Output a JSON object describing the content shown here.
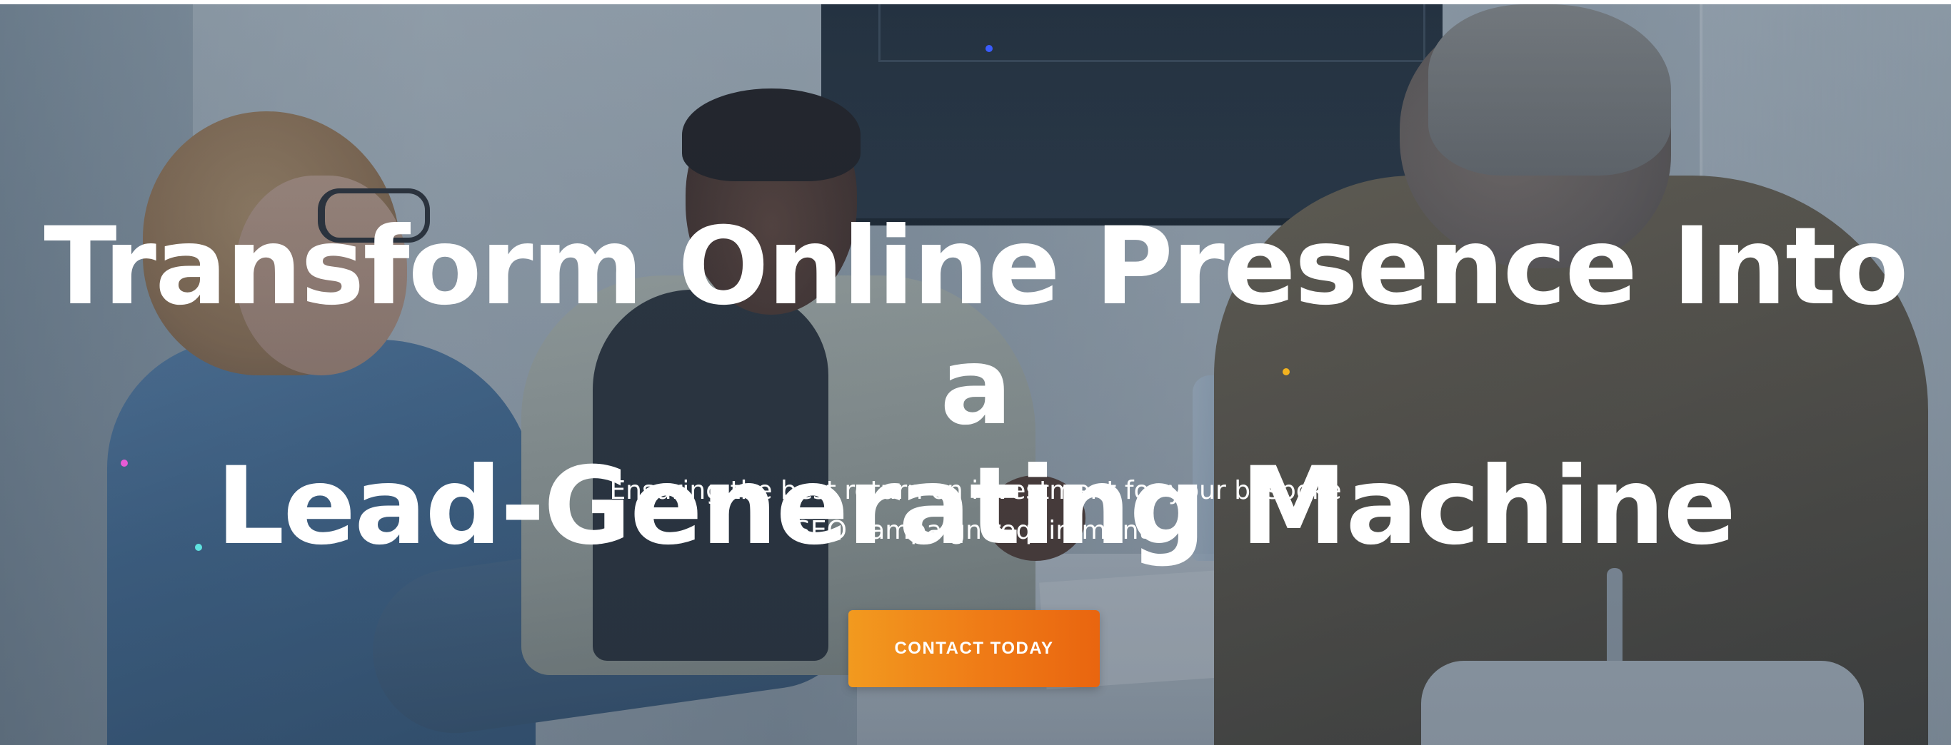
{
  "hero": {
    "headline_line1": "Transform Online Presence Into a",
    "headline_line2": "Lead-Generating Machine",
    "subtitle_line1": "Ensuring the best return on investment for your bespoke",
    "subtitle_line2": "SEO campaign requirement.",
    "cta_label": "CONTACT TODAY"
  },
  "colors": {
    "cta_gradient_start": "#f29a1f",
    "cta_gradient_end": "#e9650f",
    "headline_text": "#ffffff",
    "overlay_tint": "#30465c"
  },
  "decorative_dots": [
    {
      "name": "blue-dot",
      "color": "#3a5cff"
    },
    {
      "name": "red-dot",
      "color": "#ff3b3b"
    },
    {
      "name": "gold-dot",
      "color": "#f2b21f"
    },
    {
      "name": "pink-dot",
      "color": "#e85bd6"
    },
    {
      "name": "cyan-dot",
      "color": "#5fe3e0"
    }
  ]
}
